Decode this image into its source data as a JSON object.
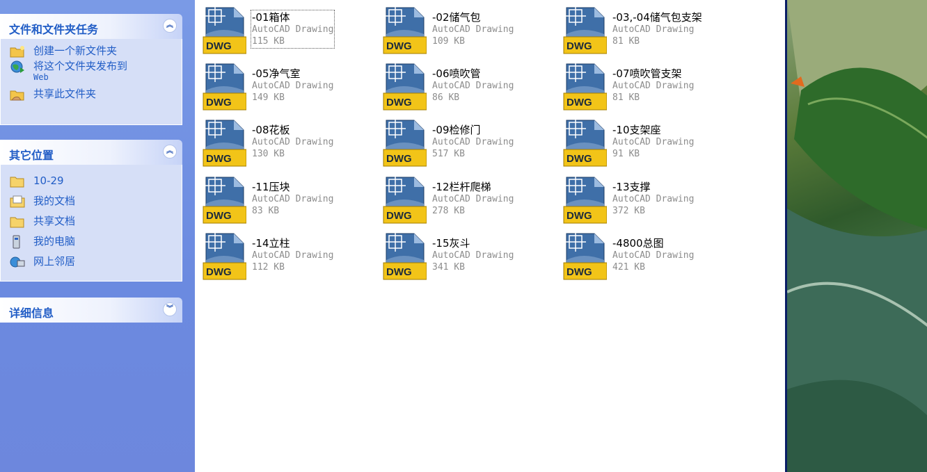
{
  "task_pane": {
    "panels": [
      {
        "title": "文件和文件夹任务",
        "collapse_glyph": "︽",
        "items": [
          {
            "label": "创建一个新文件夹",
            "icon": "new-folder-icon"
          },
          {
            "label": "将这个文件夹发布到",
            "sub": "Web",
            "icon": "publish-web-icon"
          },
          {
            "label": "共享此文件夹",
            "icon": "share-folder-icon"
          }
        ]
      },
      {
        "title": "其它位置",
        "collapse_glyph": "︽",
        "items": [
          {
            "label": "10-29",
            "icon": "folder-icon"
          },
          {
            "label": "我的文档",
            "icon": "my-documents-icon"
          },
          {
            "label": "共享文档",
            "icon": "shared-folder-icon"
          },
          {
            "label": "我的电脑",
            "icon": "my-computer-icon"
          },
          {
            "label": "网上邻居",
            "icon": "network-places-icon"
          }
        ]
      },
      {
        "title": "详细信息",
        "collapse_glyph": "︾",
        "items": []
      }
    ]
  },
  "files": [
    {
      "name": "-01箱体",
      "type": "AutoCAD Drawing",
      "size": "115 KB",
      "selected": true
    },
    {
      "name": "-02储气包",
      "type": "AutoCAD Drawing",
      "size": "109 KB"
    },
    {
      "name": "-03,-04储气包支架",
      "type": "AutoCAD Drawing",
      "size": "81 KB"
    },
    {
      "name": "-05净气室",
      "type": "AutoCAD Drawing",
      "size": "149 KB"
    },
    {
      "name": "-06喷吹管",
      "type": "AutoCAD Drawing",
      "size": "86 KB"
    },
    {
      "name": "-07喷吹管支架",
      "type": "AutoCAD Drawing",
      "size": "81 KB"
    },
    {
      "name": "-08花板",
      "type": "AutoCAD Drawing",
      "size": "130 KB"
    },
    {
      "name": "-09检修门",
      "type": "AutoCAD Drawing",
      "size": "517 KB"
    },
    {
      "name": "-10支架座",
      "type": "AutoCAD Drawing",
      "size": "91 KB"
    },
    {
      "name": "-11压块",
      "type": "AutoCAD Drawing",
      "size": "83 KB"
    },
    {
      "name": "-12栏杆爬梯",
      "type": "AutoCAD Drawing",
      "size": "278 KB"
    },
    {
      "name": "-13支撑",
      "type": "AutoCAD Drawing",
      "size": "372 KB"
    },
    {
      "name": "-14立柱",
      "type": "AutoCAD Drawing",
      "size": "112 KB"
    },
    {
      "name": "-15灰斗",
      "type": "AutoCAD Drawing",
      "size": "341 KB"
    },
    {
      "name": "-4800总图",
      "type": "AutoCAD Drawing",
      "size": "421 KB"
    }
  ],
  "file_icon": {
    "label": "DWG",
    "name": "dwg-file-icon"
  },
  "colors": {
    "pane_blue": "#6b8ae0",
    "link_blue": "#215dc6",
    "dwg_yellow": "#f2c418",
    "dwg_blue": "#2f5f98"
  }
}
